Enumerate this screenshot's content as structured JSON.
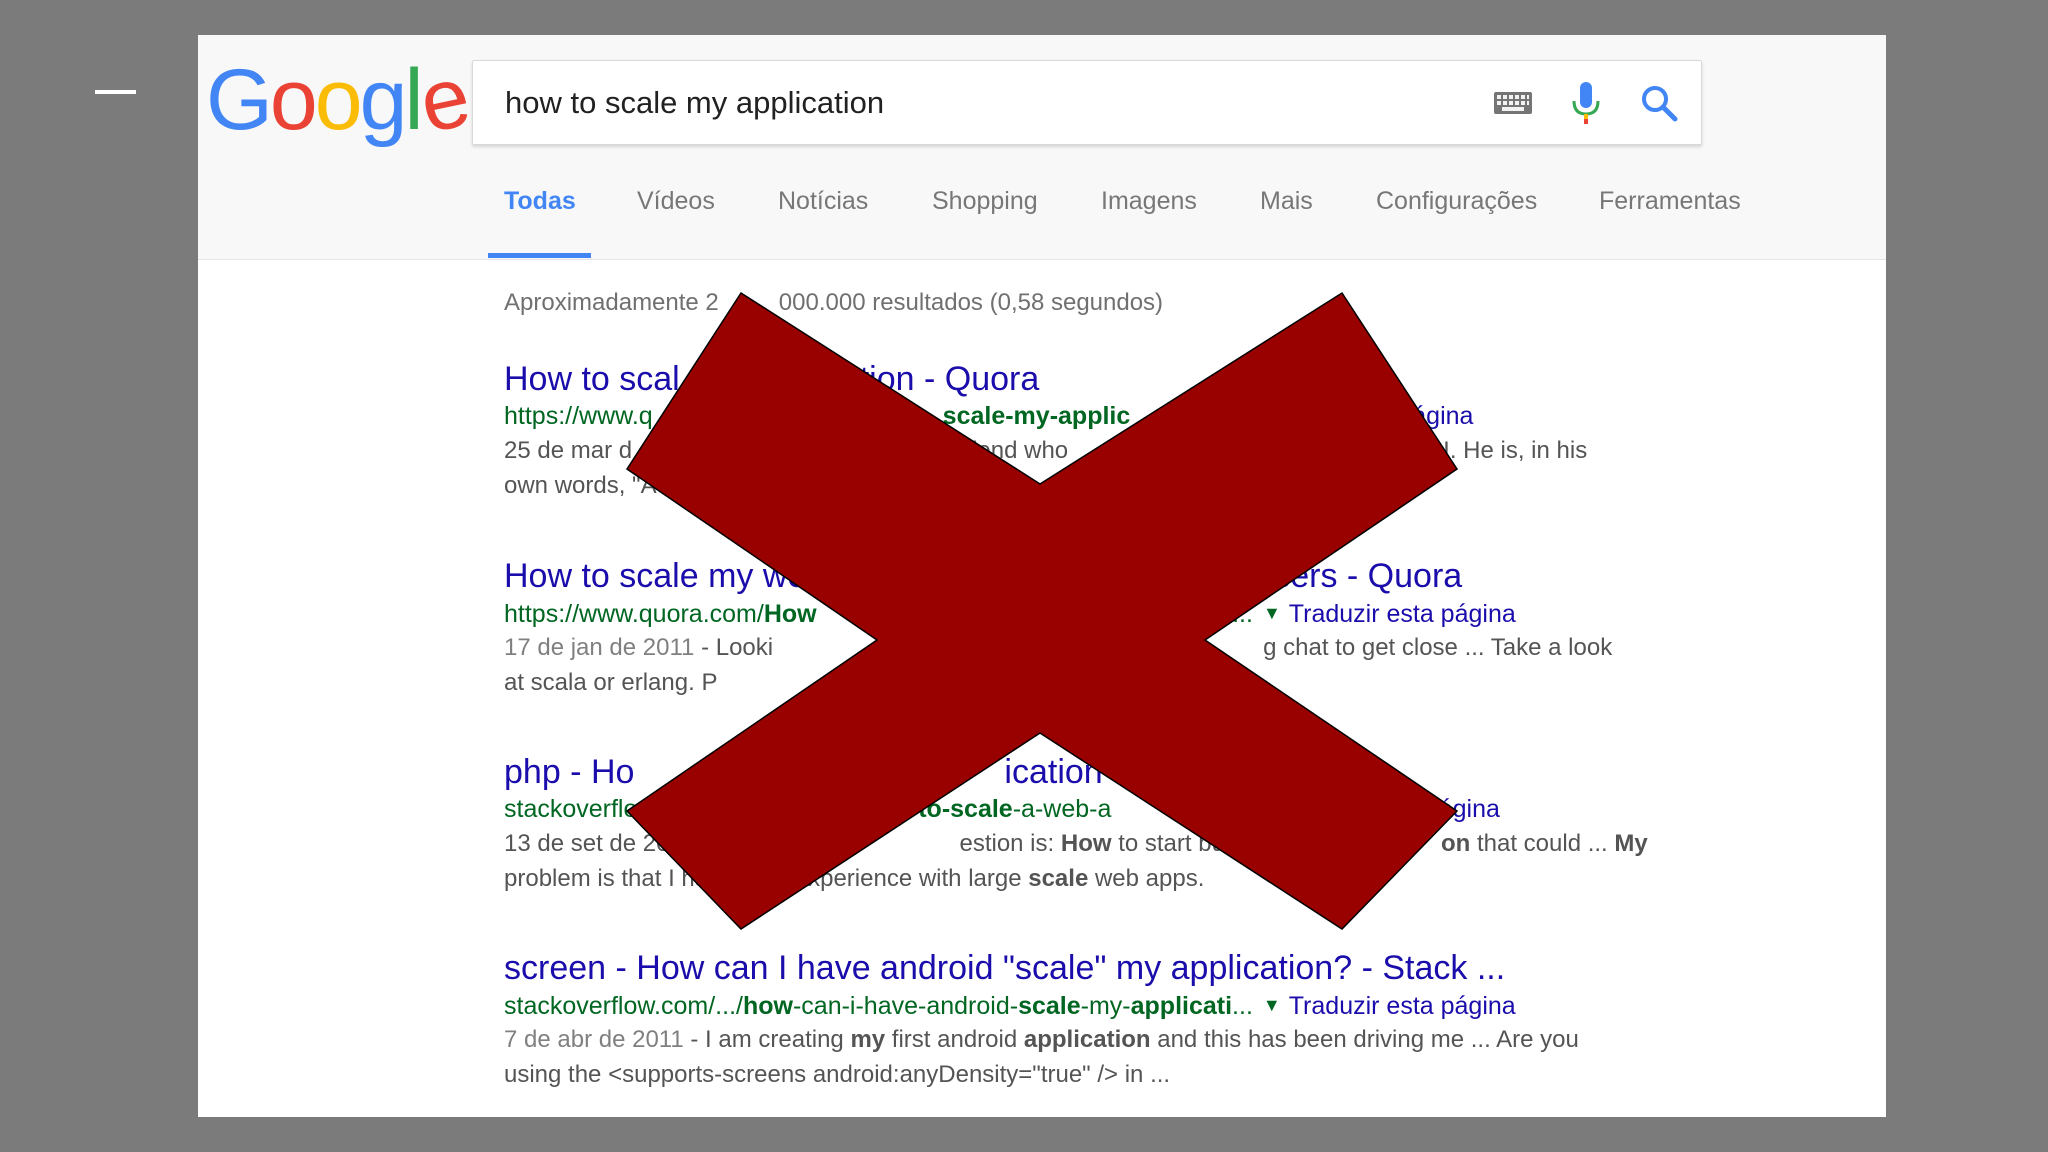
{
  "search": {
    "query": "how to scale my application"
  },
  "logo": {
    "letters": [
      "G",
      "o",
      "o",
      "g",
      "l",
      "e"
    ],
    "colors": [
      "#4285f4",
      "#ea4335",
      "#fbbc05",
      "#4285f4",
      "#34a853",
      "#ea4335"
    ]
  },
  "icons": {
    "keyboard": "keyboard-icon",
    "mic": "microphone-icon",
    "search": "search-icon"
  },
  "tabs": [
    {
      "label": "Todas",
      "active": true
    },
    {
      "label": "Vídeos",
      "active": false
    },
    {
      "label": "Notícias",
      "active": false
    },
    {
      "label": "Shopping",
      "active": false
    },
    {
      "label": "Imagens",
      "active": false
    },
    {
      "label": "Mais",
      "active": false
    },
    {
      "label": "Configurações",
      "active": false
    },
    {
      "label": "Ferramentas",
      "active": false
    }
  ],
  "stats": {
    "before": "Aproximadamente 2",
    "obscured_digits": "",
    "after": "000.000 resultados (0,58 segundos)"
  },
  "results": [
    {
      "title_left": "How to scal",
      "title_right": "tion - Quora",
      "url_left": "https://www.q",
      "url_mid_bold": "scale-my-applic",
      "url_right": "ágina",
      "snippet1_left": "25 de mar d",
      "snippet1_mid": "iend who",
      "snippet1_right": "I. He is, in his",
      "snippet2_left": "own words, \"A"
    },
    {
      "title_left": "How to scale my we",
      "title_right": "users - Quora",
      "url_left": "https://www.quora.com/",
      "url_left_bold": "How",
      "url_mid": "-to-...",
      "translate": "Traduzir esta página",
      "snippet1_date": "17 de jan de 2011",
      "snippet1_left": " - Looki",
      "snippet1_right": "g chat to get close ... Take a look",
      "snippet2_left": "at scala or erlang. P"
    },
    {
      "title_left": "php - Ho",
      "title_right": "ication -",
      "url_left": "stackoverflow",
      "url_mid_bold": "w-to-scale",
      "url_mid": "-a-web-a",
      "translate_partial": "r esta página",
      "snippet1_left": "13 de set de 20",
      "snippet1_mid_a": "estion is: ",
      "snippet1_mid_b": "How",
      "snippet1_mid_c": " to start building a",
      "snippet1_right_bold": "on",
      "snippet1_right": " that could ... ",
      "snippet1_right_bold2": "My",
      "snippet2_left": "problem is that I ha",
      "snippet2_mid": "xperience with large ",
      "snippet2_bold": "scale",
      "snippet2_right": " web apps."
    },
    {
      "title": "screen - How can I have android \"scale\" my application? - Stack ...",
      "url_pre": "stackoverflow.com/.../",
      "url_bold1": "how",
      "url_mid1": "-can-i-have-android-",
      "url_bold2": "scale",
      "url_mid2": "-my-",
      "url_bold3": "applicati",
      "url_post": "...",
      "translate": "Traduzir esta página",
      "snippet1_date": "7 de abr de 2011",
      "snippet1_a": " - I am creating ",
      "snippet1_b": "my",
      "snippet1_c": " first android ",
      "snippet1_d": "application",
      "snippet1_e": " and this has been driving me ... Are you",
      "snippet2": "using the <supports-screens android:anyDensity=\"true\" /> in ..."
    }
  ],
  "overlay": {
    "color": "#990000"
  }
}
